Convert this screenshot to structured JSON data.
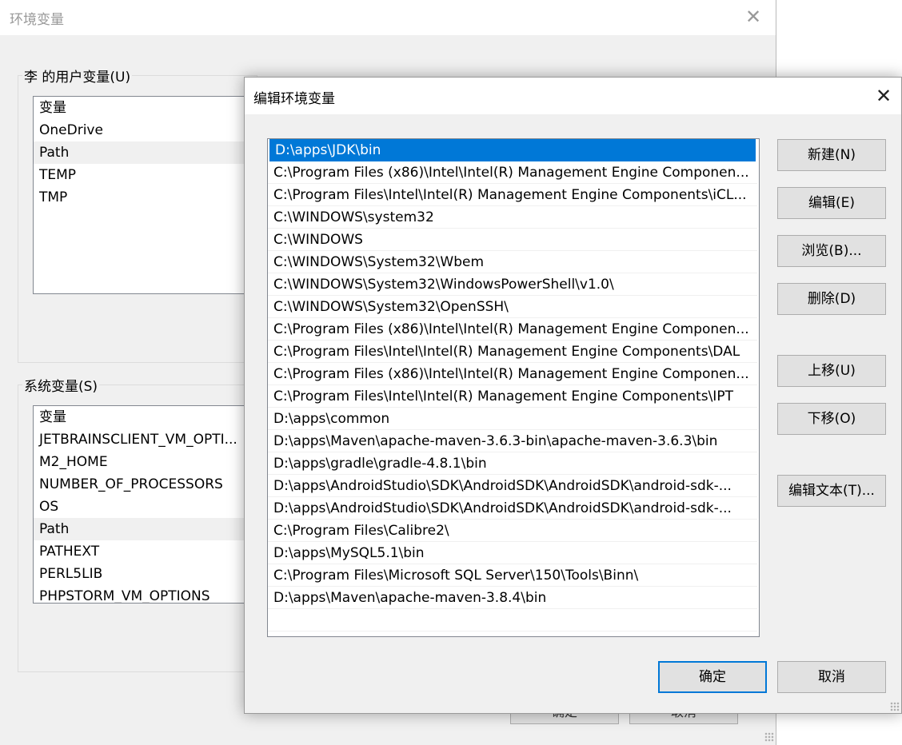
{
  "background_window": {
    "title": "环境变量",
    "user_vars": {
      "group_title": "李 的用户变量(U)",
      "header": "变量",
      "rows": [
        "OneDrive",
        "Path",
        "TEMP",
        "TMP"
      ],
      "selected": "Path"
    },
    "system_vars": {
      "group_title": "系统变量(S)",
      "header": "变量",
      "rows": [
        "JETBRAINSCLIENT_VM_OPTI...",
        "M2_HOME",
        "NUMBER_OF_PROCESSORS",
        "OS",
        "Path",
        "PATHEXT",
        "PERL5LIB",
        "PHPSTORM_VM_OPTIONS"
      ],
      "selected": "Path"
    },
    "buttons": {
      "ok": "确定",
      "cancel": "取消"
    }
  },
  "dialog": {
    "title": "编辑环境变量",
    "selected_index": 0,
    "paths": [
      "D:\\apps\\JDK\\bin",
      "C:\\Program Files (x86)\\Intel\\Intel(R) Management Engine Componen...",
      "C:\\Program Files\\Intel\\Intel(R) Management Engine Components\\iCL...",
      "C:\\WINDOWS\\system32",
      "C:\\WINDOWS",
      "C:\\WINDOWS\\System32\\Wbem",
      "C:\\WINDOWS\\System32\\WindowsPowerShell\\v1.0\\",
      "C:\\WINDOWS\\System32\\OpenSSH\\",
      "C:\\Program Files (x86)\\Intel\\Intel(R) Management Engine Componen...",
      "C:\\Program Files\\Intel\\Intel(R) Management Engine Components\\DAL",
      "C:\\Program Files (x86)\\Intel\\Intel(R) Management Engine Componen...",
      "C:\\Program Files\\Intel\\Intel(R) Management Engine Components\\IPT",
      "D:\\apps\\common",
      "D:\\apps\\Maven\\apache-maven-3.6.3-bin\\apache-maven-3.6.3\\bin",
      "D:\\apps\\gradle\\gradle-4.8.1\\bin",
      "D:\\apps\\AndroidStudio\\SDK\\AndroidSDK\\AndroidSDK\\android-sdk-...",
      "D:\\apps\\AndroidStudio\\SDK\\AndroidSDK\\AndroidSDK\\android-sdk-...",
      "C:\\Program Files\\Calibre2\\",
      "D:\\apps\\MySQL5.1\\bin",
      "C:\\Program Files\\Microsoft SQL Server\\150\\Tools\\Binn\\",
      "D:\\apps\\Maven\\apache-maven-3.8.4\\bin"
    ],
    "buttons": {
      "new": "新建(N)",
      "edit": "编辑(E)",
      "browse": "浏览(B)...",
      "delete": "删除(D)",
      "move_up": "上移(U)",
      "move_down": "下移(O)",
      "edit_text": "编辑文本(T)...",
      "ok": "确定",
      "cancel": "取消"
    },
    "close_icon": "close-icon",
    "accent_color": "#0078d7"
  }
}
